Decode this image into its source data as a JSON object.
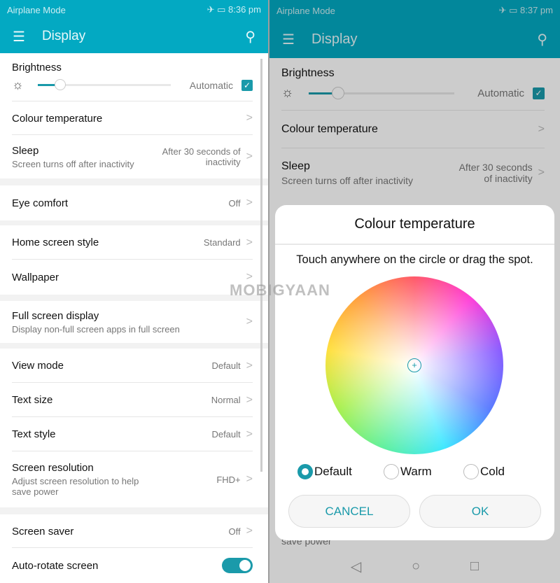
{
  "left": {
    "status": {
      "carrier": "Airplane Mode",
      "time": "8:36 pm"
    },
    "toolbar": {
      "title": "Display"
    },
    "brightness": {
      "label": "Brightness",
      "level": 0.17,
      "automatic_label": "Automatic",
      "automatic": true
    },
    "rows": [
      {
        "label": "Colour temperature",
        "sub": "",
        "value": ""
      },
      {
        "label": "Sleep",
        "sub": "Screen turns off after inactivity",
        "value": "After 30 seconds of inactivity"
      },
      {
        "label": "Eye comfort",
        "sub": "",
        "value": "Off"
      },
      {
        "label": "Home screen style",
        "sub": "",
        "value": "Standard"
      },
      {
        "label": "Wallpaper",
        "sub": "",
        "value": ""
      },
      {
        "label": "Full screen display",
        "sub": "Display non-full screen apps in full screen",
        "value": ""
      },
      {
        "label": "View mode",
        "sub": "",
        "value": "Default"
      },
      {
        "label": "Text size",
        "sub": "",
        "value": "Normal"
      },
      {
        "label": "Text style",
        "sub": "",
        "value": "Default"
      },
      {
        "label": "Screen resolution",
        "sub": "Adjust screen resolution to help save power",
        "value": "FHD+"
      },
      {
        "label": "Screen saver",
        "sub": "",
        "value": "Off"
      },
      {
        "label": "Auto-rotate screen",
        "sub": "",
        "value": "",
        "toggle": true
      }
    ]
  },
  "right": {
    "status": {
      "carrier": "Airplane Mode",
      "time": "8:37 pm"
    },
    "toolbar": {
      "title": "Display"
    },
    "brightness": {
      "label": "Brightness",
      "level": 0.2,
      "automatic_label": "Automatic"
    },
    "rows": [
      {
        "label": "Colour temperature"
      },
      {
        "label": "Sleep",
        "sub": "Screen turns off after inactivity",
        "value": "After 30 seconds of inactivity"
      }
    ],
    "behind_text": "save power",
    "dialog": {
      "title": "Colour temperature",
      "hint": "Touch anywhere on the circle or drag the spot.",
      "options": [
        "Default",
        "Warm",
        "Cold"
      ],
      "selected": "Default",
      "cancel": "CANCEL",
      "ok": "OK"
    }
  },
  "watermark": "MOBIGYAAN",
  "accent": "#03a9c2"
}
